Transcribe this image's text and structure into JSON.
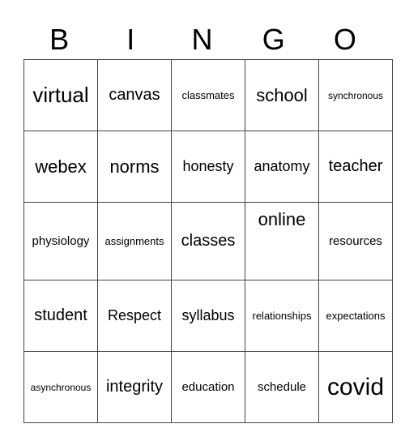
{
  "header": [
    "B",
    "I",
    "N",
    "G",
    "O"
  ],
  "rows": [
    [
      "virtual",
      "canvas",
      "classmates",
      "school",
      "synchronous"
    ],
    [
      "webex",
      "norms",
      "honesty",
      "anatomy",
      "teacher"
    ],
    [
      "physiology",
      "assignments",
      "classes",
      "online",
      "resources"
    ],
    [
      "student",
      "Respect",
      "syllabus",
      "relationships",
      "expectations"
    ],
    [
      "asynchronous",
      "integrity",
      "education",
      "schedule",
      "covid"
    ]
  ]
}
